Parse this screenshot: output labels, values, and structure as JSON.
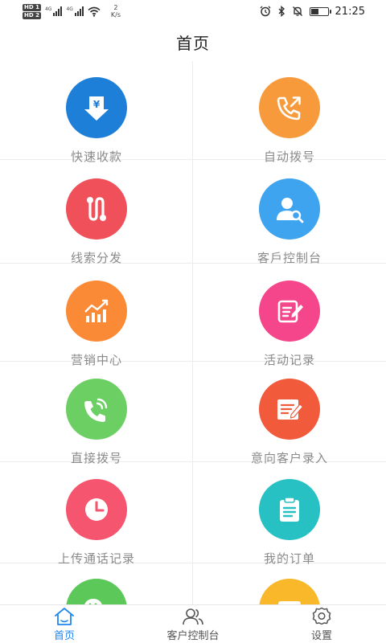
{
  "status_bar": {
    "sim1": "HD 1",
    "sim2": "HD 2",
    "network1": "4G",
    "network2": "4G",
    "speed_value": "2",
    "speed_unit": "K/s",
    "time": "21:25",
    "battery_level": 0.45
  },
  "header": {
    "title": "首页"
  },
  "grid": {
    "items": [
      {
        "label": "快速收款",
        "icon": "yuan-download-icon",
        "color": "#1e7fd8"
      },
      {
        "label": "自动拨号",
        "icon": "phone-outgoing-icon",
        "color": "#f79a3c"
      },
      {
        "label": "线索分发",
        "icon": "route-icon",
        "color": "#f0505a"
      },
      {
        "label": "客戶控制台",
        "icon": "user-search-icon",
        "color": "#3ea4f0"
      },
      {
        "label": "营销中心",
        "icon": "growth-chart-icon",
        "color": "#fb8a36"
      },
      {
        "label": "活动记录",
        "icon": "edit-note-icon",
        "color": "#f5468b"
      },
      {
        "label": "直接拨号",
        "icon": "phone-ring-icon",
        "color": "#6ccf63"
      },
      {
        "label": "意向客户录入",
        "icon": "form-edit-icon",
        "color": "#f15a3a"
      },
      {
        "label": "上传通话记录",
        "icon": "clock-icon",
        "color": "#f5556e"
      },
      {
        "label": "我的订单",
        "icon": "clipboard-icon",
        "color": "#27c1c4"
      },
      {
        "label": "",
        "icon": "wechat-icon",
        "color": "#5cc85a"
      },
      {
        "label": "",
        "icon": "card-icon",
        "color": "#f8b82a"
      }
    ]
  },
  "tab_bar": {
    "tabs": [
      {
        "label": "首页",
        "icon": "home-icon",
        "active": true
      },
      {
        "label": "客户控制台",
        "icon": "users-icon",
        "active": false
      },
      {
        "label": "设置",
        "icon": "gear-icon",
        "active": false
      }
    ],
    "active_color": "#1d86f0"
  }
}
